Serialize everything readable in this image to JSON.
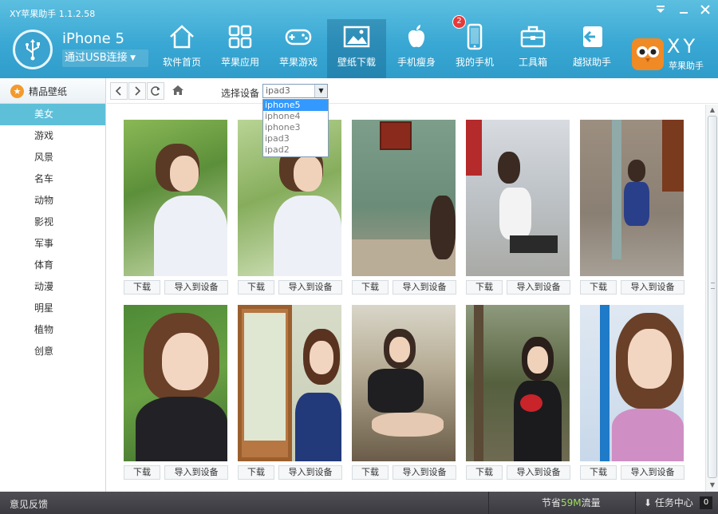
{
  "app": {
    "title": "XY苹果助手 1.1.2.58",
    "device_name": "iPhone 5",
    "connection": "通过USB连接",
    "brand_text": "XY",
    "brand_sub": "苹果助手"
  },
  "nav": {
    "items": [
      {
        "label": "软件首页",
        "icon": "home-icon"
      },
      {
        "label": "苹果应用",
        "icon": "grid-icon"
      },
      {
        "label": "苹果游戏",
        "icon": "gamepad-icon"
      },
      {
        "label": "壁纸下载",
        "icon": "picture-icon"
      },
      {
        "label": "手机瘦身",
        "icon": "apple-icon"
      },
      {
        "label": "我的手机",
        "icon": "phone-icon"
      },
      {
        "label": "工具箱",
        "icon": "toolbox-icon"
      },
      {
        "label": "越狱助手",
        "icon": "exit-arrow-icon"
      }
    ],
    "active": "壁纸下载",
    "badge": "2"
  },
  "sidebar": {
    "title": "精品壁纸",
    "categories": [
      "美女",
      "游戏",
      "风景",
      "名车",
      "动物",
      "影视",
      "军事",
      "体育",
      "动漫",
      "明星",
      "植物",
      "创意"
    ],
    "active": "美女"
  },
  "toolbar": {
    "back": "‹",
    "forward": "›",
    "refresh": "↻",
    "select_label": "选择设备",
    "selected_device": "ipad3",
    "options": [
      "iphone5",
      "iphone4",
      "iphone3",
      "ipad3",
      "ipad2"
    ],
    "highlighted_option": "iphone5"
  },
  "gallery": {
    "download_label": "下载",
    "import_label": "导入到设备",
    "count": 10
  },
  "statusbar": {
    "feedback": "意见反馈",
    "traffic_prefix": "节省",
    "traffic_amount": "59M",
    "traffic_suffix": "流量",
    "task_center": "任务中心",
    "task_count": "0"
  },
  "colors": {
    "header": "#3aa8d4",
    "active_category": "#5ebfd9",
    "status_bar": "#444449",
    "badge": "#e63a3a"
  }
}
